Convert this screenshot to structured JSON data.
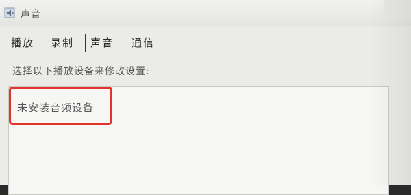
{
  "window": {
    "title": "声音",
    "icon": "speaker-icon"
  },
  "tabs": [
    {
      "label": "播放"
    },
    {
      "label": "录制"
    },
    {
      "label": "声音"
    },
    {
      "label": "通信"
    }
  ],
  "instruction": "选择以下播放设备来修改设置:",
  "device_list": {
    "empty_message": "未安装音频设备"
  },
  "colors": {
    "highlight": "#e0342a",
    "window_bg": "#ebebe8"
  }
}
